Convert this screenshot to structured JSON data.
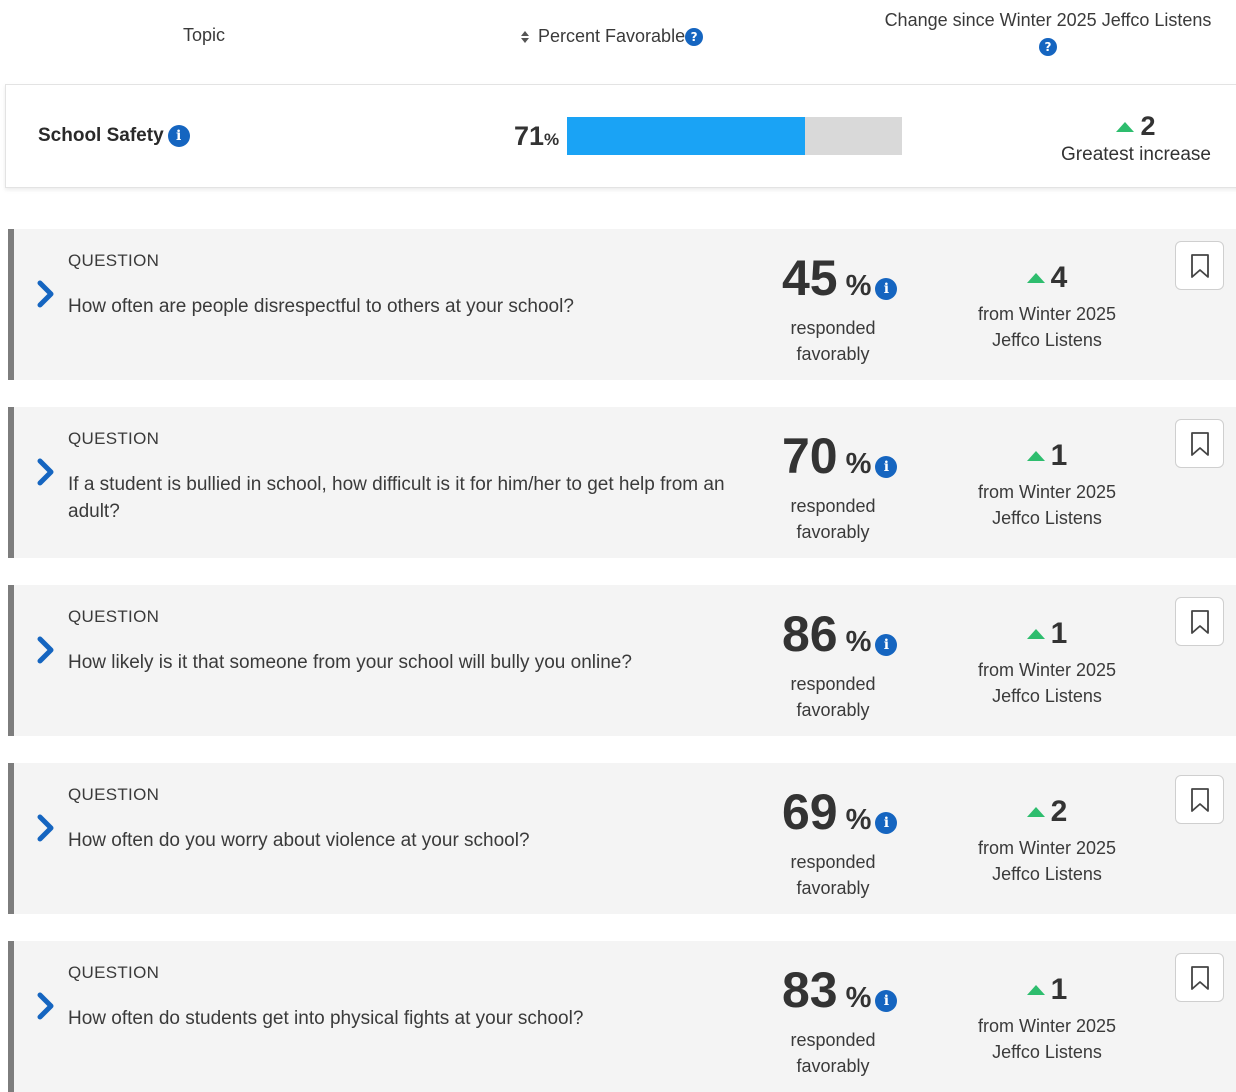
{
  "header": {
    "topic_label": "Topic",
    "favorable_label": "Percent Favorable",
    "change_label": "Change since Winter 2025 Jeffco Listens"
  },
  "topic": {
    "name": "School Safety",
    "percent": 71,
    "percent_text": "71",
    "percent_symbol": "%",
    "change_value": "2",
    "change_label": "Greatest increase",
    "bar_fill_color": "#1aa3f5",
    "bar_track_color": "#d9d9d9"
  },
  "question_label": "QUESTION",
  "responded_text": "responded favorably",
  "from_text": "from Winter 2025 Jeffco Listens",
  "questions": [
    {
      "text": "How often are people disrespectful to others at your school?",
      "percent": "45",
      "change": "4"
    },
    {
      "text": "If a student is bullied in school, how difficult is it for him/her to get help from an adult?",
      "percent": "70",
      "change": "1"
    },
    {
      "text": "How likely is it that someone from your school will bully you online?",
      "percent": "86",
      "change": "1"
    },
    {
      "text": "How often do you worry about violence at your school?",
      "percent": "69",
      "change": "2"
    },
    {
      "text": "How often do students get into physical fights at your school?",
      "percent": "83",
      "change": "1"
    }
  ],
  "colors": {
    "accent_blue": "#1565c0",
    "increase_green": "#2ebd6e",
    "row_border": "#7d7d7d"
  },
  "icons": [
    "sort-icon",
    "help-icon",
    "info-icon",
    "chevron-right-icon",
    "triangle-up-icon",
    "bookmark-icon"
  ]
}
